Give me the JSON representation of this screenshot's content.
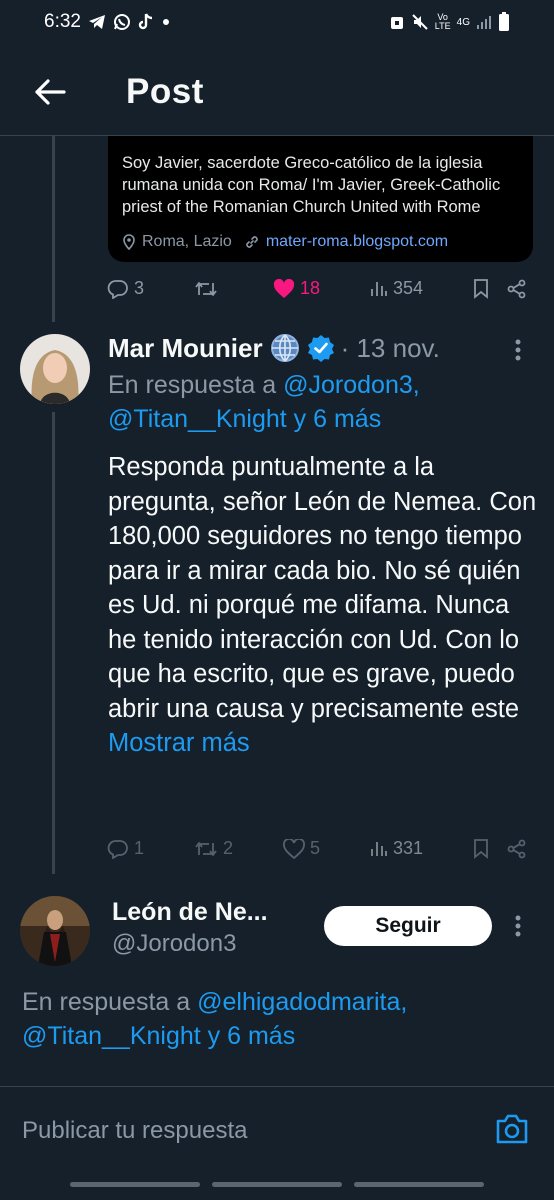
{
  "status_bar": {
    "time": "6:32",
    "network_label": "Vo LTE",
    "network_gen": "4G"
  },
  "header": {
    "title": "Post"
  },
  "quoted_card": {
    "bio": "Soy Javier, sacerdote Greco-católico de la iglesia rumana unida con Roma/ I'm Javier, Greek-Catholic priest of the Romanian Church United with Rome",
    "location": "Roma, Lazio",
    "link": "mater-roma.blogspot.com"
  },
  "actions_1": {
    "replies": "3",
    "retweets": "",
    "likes": "18",
    "views": "354"
  },
  "tweet": {
    "author": "Mar Mounier",
    "date": "· 13 nov.",
    "reply_prefix": "En respuesta a ",
    "reply_mention1": "@Jorodon3,",
    "reply_mention2": "@Titan__Knight",
    "reply_suffix": " y 6 más",
    "body": "Responda puntualmente a la pregunta, señor León de Nemea. Con 180,000 seguidores no tengo tiempo para ir a mirar cada bio. No sé quién es Ud. ni porqué me difama. Nunca he tenido interacción con Ud. Con lo que ha escrito, que es grave, puedo abrir una causa y precisamente este ",
    "show_more": "Mostrar más"
  },
  "actions_2": {
    "replies": "1",
    "retweets": "2",
    "likes": "5",
    "views": "331"
  },
  "user2": {
    "name": "León de Ne...",
    "handle": "@Jorodon3",
    "follow_label": "Seguir",
    "reply_prefix": "En respuesta a ",
    "reply_mention1": "@elhigadodmarita,",
    "reply_mention2": "@Titan__Knight",
    "reply_suffix": " y 6 más"
  },
  "composer": {
    "placeholder": "Publicar tu respuesta"
  },
  "colors": {
    "background": "#15202b",
    "accent": "#1d9bf0",
    "like": "#f91880",
    "verified": "#1d9bf0"
  }
}
